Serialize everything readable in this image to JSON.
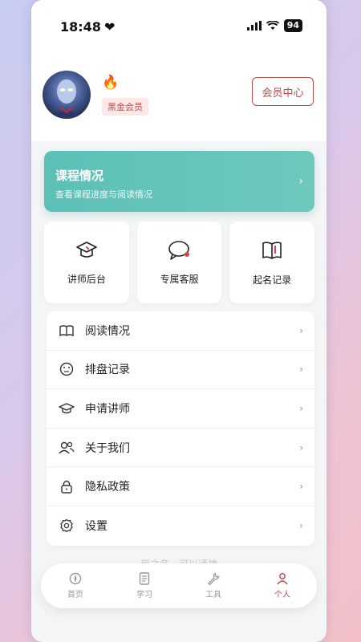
{
  "status_bar": {
    "time": "18:48",
    "battery": "94"
  },
  "profile": {
    "badge": "黑金会员",
    "member_button": "会员中心"
  },
  "course_card": {
    "title": "课程情况",
    "subtitle": "查看课程进度与阅读情况"
  },
  "quick_actions": [
    {
      "label": "讲师后台",
      "icon": "graduation-cap-icon"
    },
    {
      "label": "专属客服",
      "icon": "chat-bubble-icon"
    },
    {
      "label": "起名记录",
      "icon": "book-icon"
    }
  ],
  "menu": [
    {
      "label": "阅读情况",
      "icon": "open-book-icon"
    },
    {
      "label": "排盘记录",
      "icon": "compass-icon"
    },
    {
      "label": "申请讲师",
      "icon": "graduation-cap-icon"
    },
    {
      "label": "关于我们",
      "icon": "users-icon"
    },
    {
      "label": "隐私政策",
      "icon": "lock-icon"
    },
    {
      "label": "设置",
      "icon": "gear-icon"
    }
  ],
  "footer_text": "用之名，可以通神",
  "tabs": [
    {
      "label": "首页",
      "icon": "home-icon",
      "active": false
    },
    {
      "label": "学习",
      "icon": "notebook-icon",
      "active": false
    },
    {
      "label": "工具",
      "icon": "wrench-icon",
      "active": false
    },
    {
      "label": "个人",
      "icon": "person-icon",
      "active": true
    }
  ],
  "colors": {
    "accent": "#b84a4a",
    "teal": "#5cc0b6",
    "badge_bg": "#fde8e8"
  }
}
